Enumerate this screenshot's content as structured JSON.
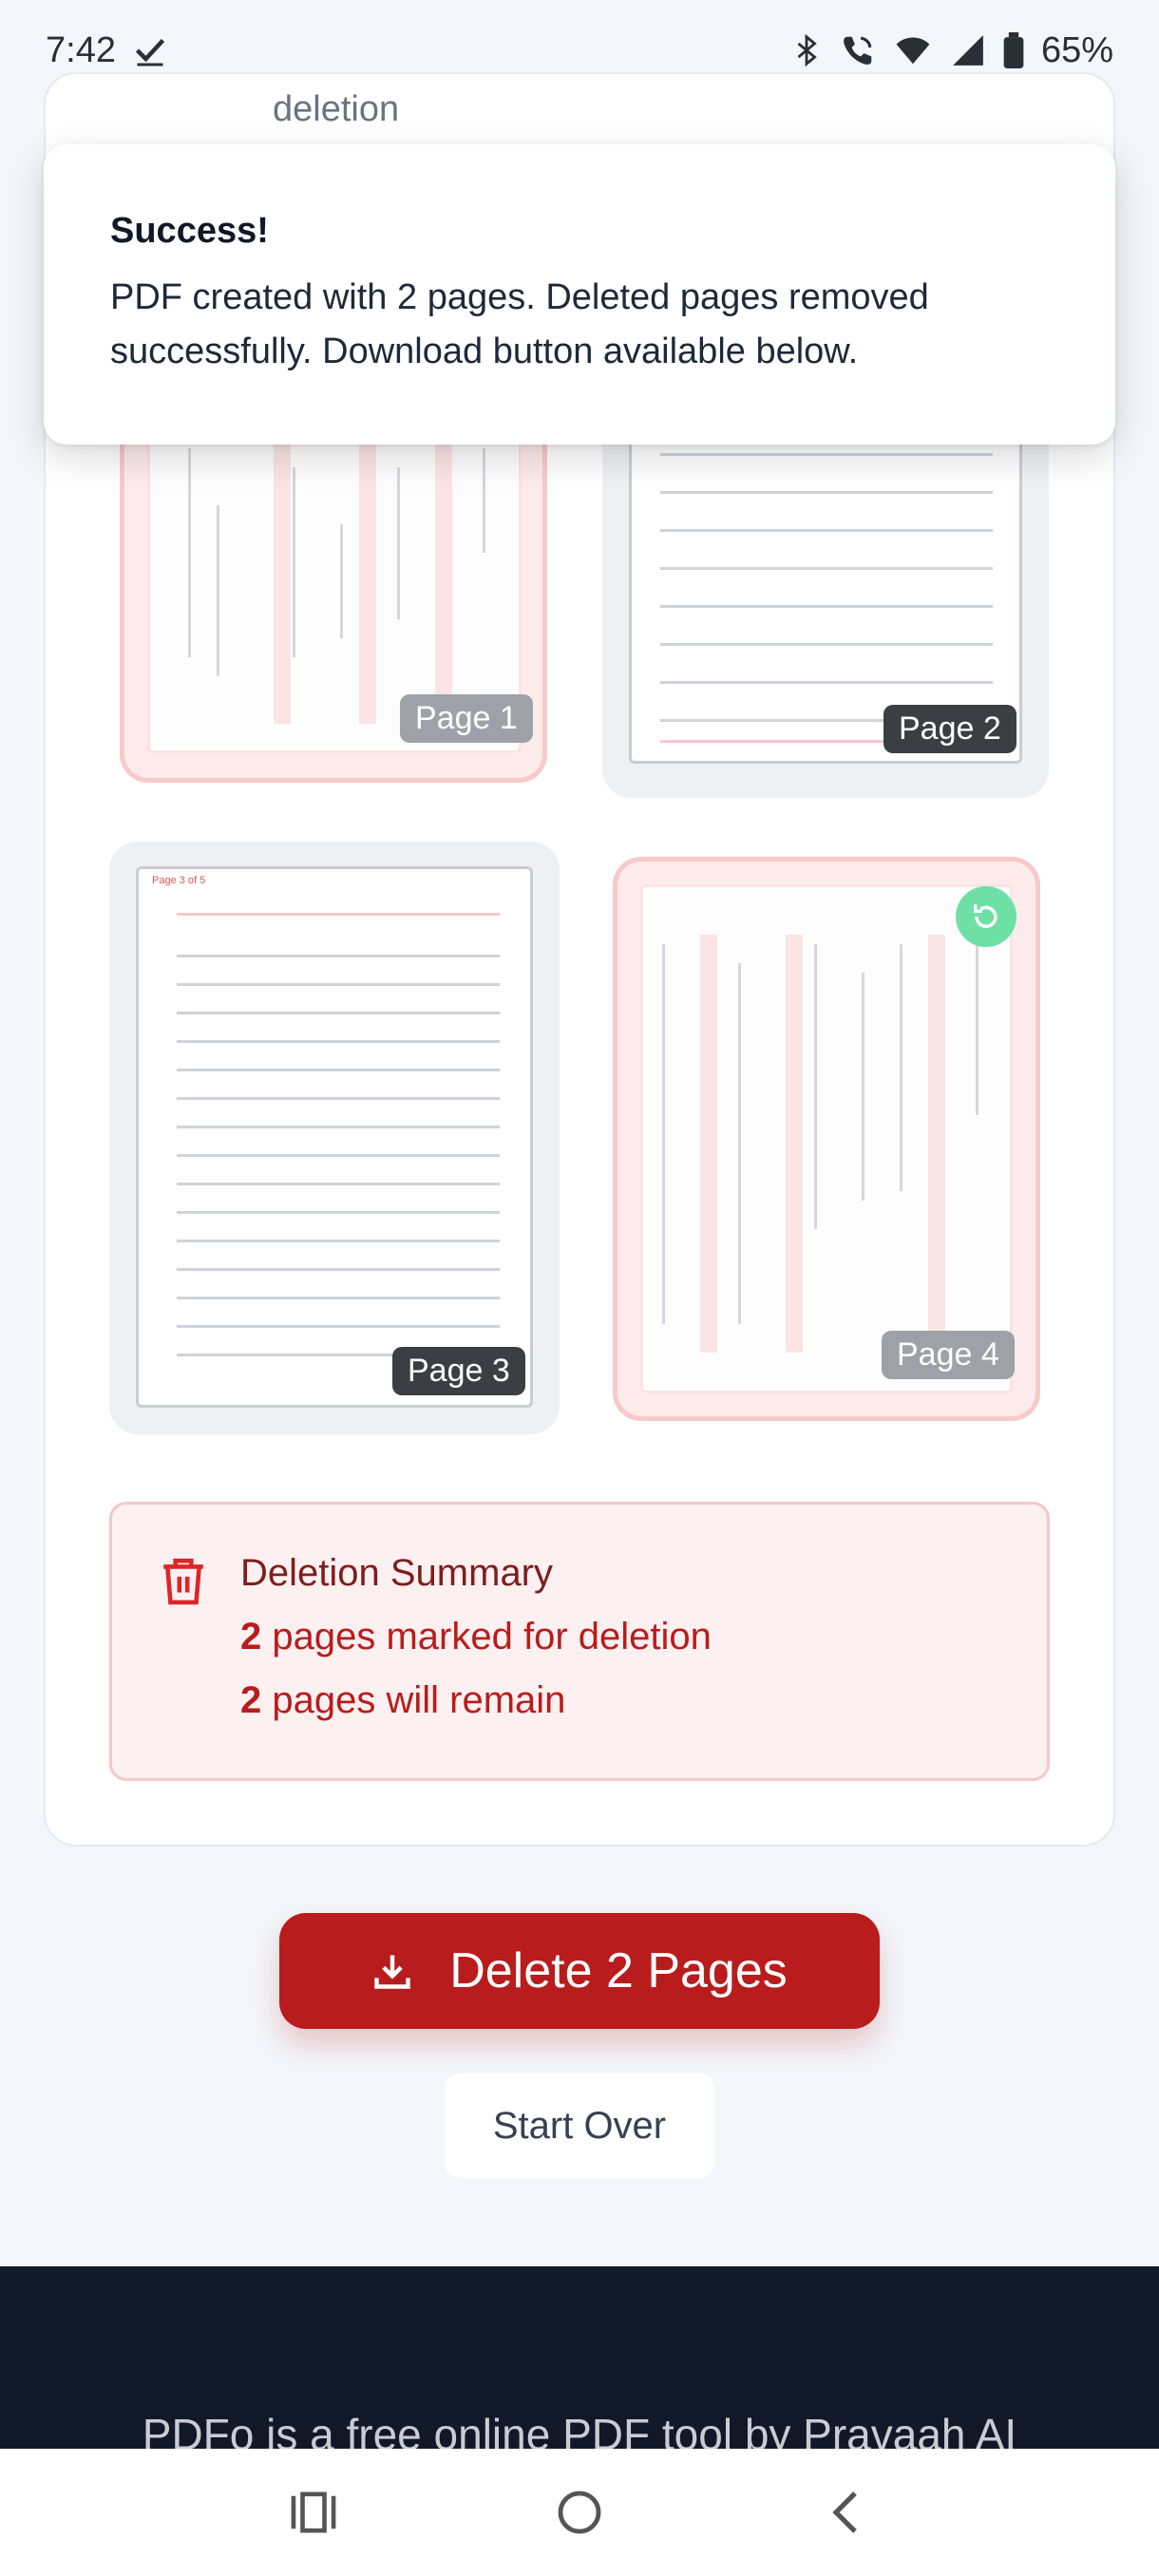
{
  "status_bar": {
    "time": "7:42",
    "battery": "65%",
    "icons": [
      "check-icon",
      "bluetooth-icon",
      "wifi-call-icon",
      "wifi-icon",
      "signal-icon",
      "battery-icon"
    ]
  },
  "card": {
    "cut_off_text": "deletion"
  },
  "toast": {
    "title": "Success!",
    "message": "PDF created with 2 pages. Deleted pages removed successfully. Download button available below."
  },
  "pages": [
    {
      "label": "Page 1",
      "marked_for_deletion": true
    },
    {
      "label": "Page 2",
      "marked_for_deletion": false
    },
    {
      "label": "Page 3",
      "marked_for_deletion": false,
      "header_text": "Page 3 of 5"
    },
    {
      "label": "Page 4",
      "marked_for_deletion": true
    }
  ],
  "summary": {
    "title": "Deletion Summary",
    "deleted_count": "2",
    "deleted_text": "pages marked for deletion",
    "remaining_count": "2",
    "remaining_text": "pages will remain"
  },
  "actions": {
    "delete_label": "Delete 2 Pages",
    "start_over_label": "Start Over"
  },
  "footer": {
    "text": "PDFo is a free online PDF tool by Pravaah AI"
  },
  "colors": {
    "accent_red": "#b91c1c",
    "summary_bg": "#fdf0f0",
    "restore_green": "#6ee0a6",
    "footer_bg": "#111827"
  }
}
